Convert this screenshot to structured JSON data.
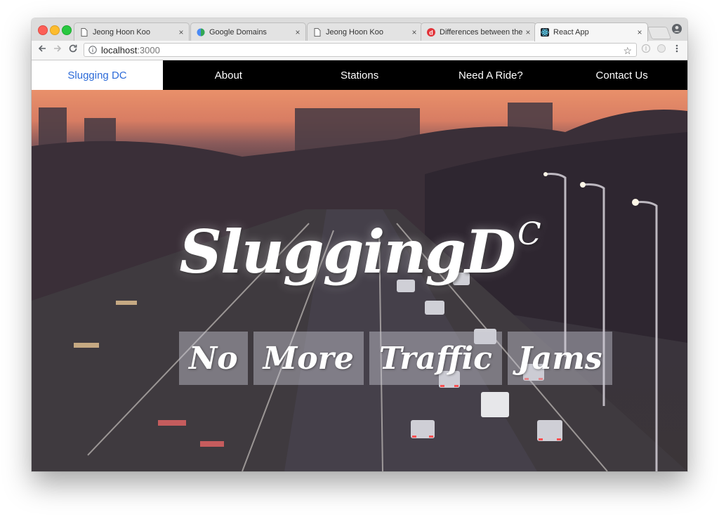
{
  "browser": {
    "tabs": [
      {
        "title": "Jeong Hoon Koo",
        "icon": "document-icon"
      },
      {
        "title": "Google Domains",
        "icon": "google-domains-icon"
      },
      {
        "title": "Jeong Hoon Koo",
        "icon": "document-icon"
      },
      {
        "title": "Differences between the ",
        "icon": "d-logo-icon"
      },
      {
        "title": "React App",
        "icon": "react-icon",
        "active": true
      }
    ],
    "close_glyph": "×",
    "address": {
      "host": "localhost",
      "port": ":3000"
    }
  },
  "nav": {
    "brand": "Slugging DC",
    "items": [
      "About",
      "Stations",
      "Need A Ride?",
      "Contact Us"
    ]
  },
  "hero": {
    "title": "SluggingD",
    "title_super": "C",
    "words": [
      "No",
      "More",
      "Traffic",
      "Jams"
    ]
  },
  "colors": {
    "brand_text": "#2d6bd8",
    "nav_bg": "#000000",
    "word_bg": "rgba(200,200,210,0.45)"
  }
}
